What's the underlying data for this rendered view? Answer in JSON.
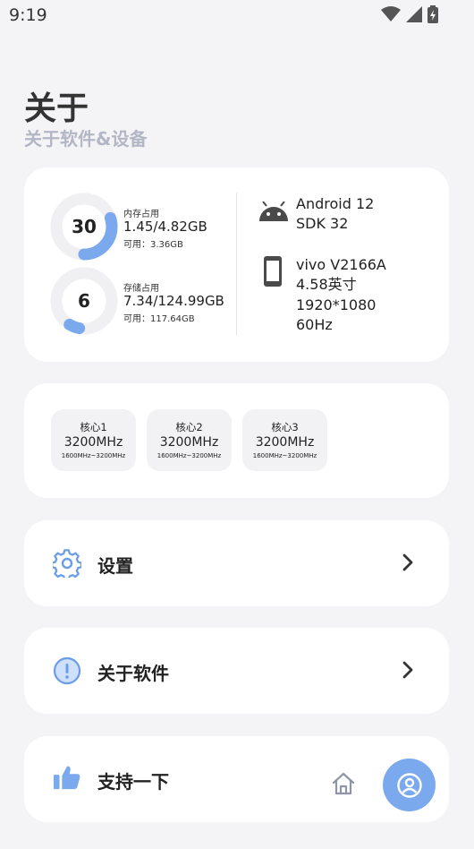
{
  "status_bar": {
    "time": "9:19",
    "icons": [
      "wifi-icon",
      "signal-icon",
      "battery-charging-icon"
    ]
  },
  "header": {
    "title": "关于",
    "subtitle": "关于软件&设备"
  },
  "memory": {
    "percent": 30,
    "label": "内存占用",
    "usage": "1.45/4.82GB",
    "available": "可用：3.36GB"
  },
  "storage": {
    "percent": 6,
    "label": "存储占用",
    "usage": "7.34/124.99GB",
    "available": "可用：117.64GB"
  },
  "device": {
    "android_version": "Android 12",
    "sdk": "SDK 32",
    "model": "vivo V2166A",
    "screen_size": "4.58英寸",
    "resolution": "1920*1080",
    "refresh_rate": "60Hz"
  },
  "cpu": {
    "cores": [
      {
        "name": "核心1",
        "freq": "3200MHz",
        "range": "1600MHz~3200MHz"
      },
      {
        "name": "核心2",
        "freq": "3200MHz",
        "range": "1600MHz~3200MHz"
      },
      {
        "name": "核心3",
        "freq": "3200MHz",
        "range": "1600MHz~3200MHz"
      }
    ]
  },
  "menu": {
    "settings_label": "设置",
    "about_label": "关于软件",
    "support_label": "支持一下"
  },
  "colors": {
    "accent": "#7ba9ee",
    "ring_track": "#f0f0f3",
    "background": "#f4f4f6"
  }
}
